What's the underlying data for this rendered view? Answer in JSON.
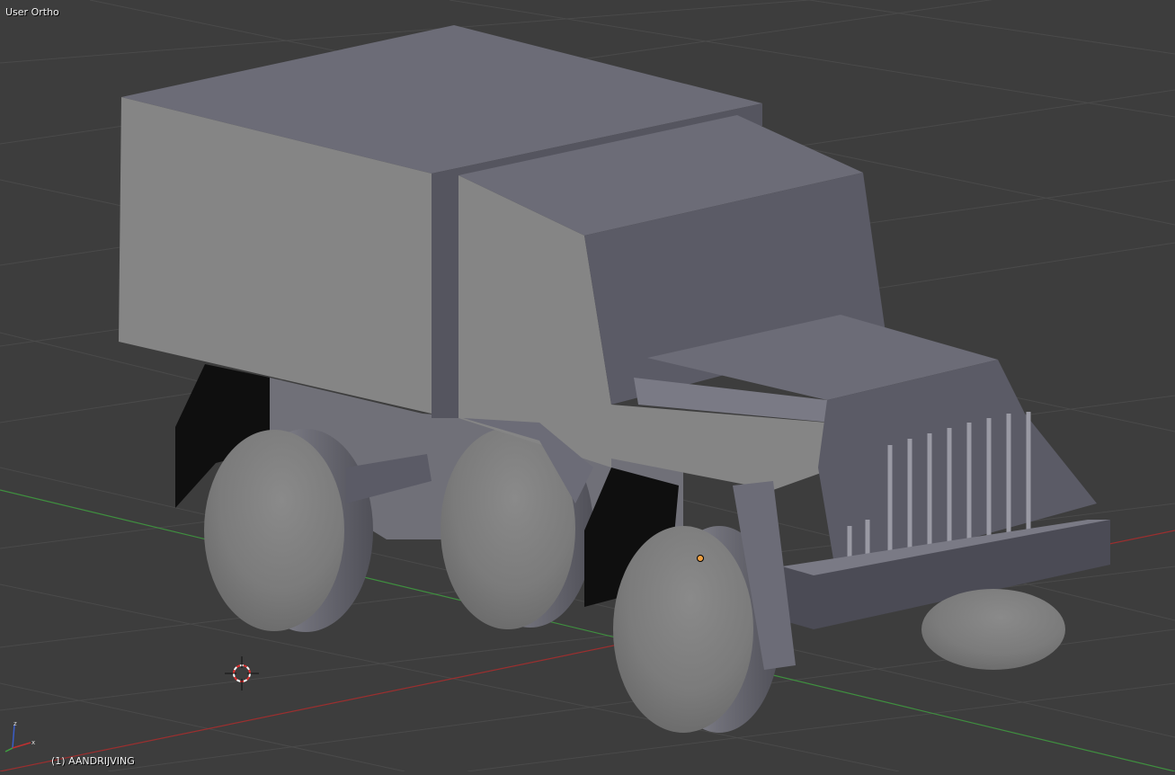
{
  "viewport": {
    "view_label": "User Ortho",
    "object_label": "(1) AANDRIJVING"
  },
  "colors": {
    "background": "#3d3d3d",
    "grid": "#4a4a4a",
    "x_axis": "#9b2f2f",
    "y_axis": "#3f8f3f",
    "body_top": "#6c6c77",
    "body_side": "#858585",
    "body_front": "#5b5b66"
  },
  "icons": {
    "cursor": "3d-cursor-icon",
    "origin": "object-origin-icon",
    "gizmo": "axis-gizmo-icon"
  },
  "gizmo": {
    "z": "z",
    "x": "x"
  }
}
